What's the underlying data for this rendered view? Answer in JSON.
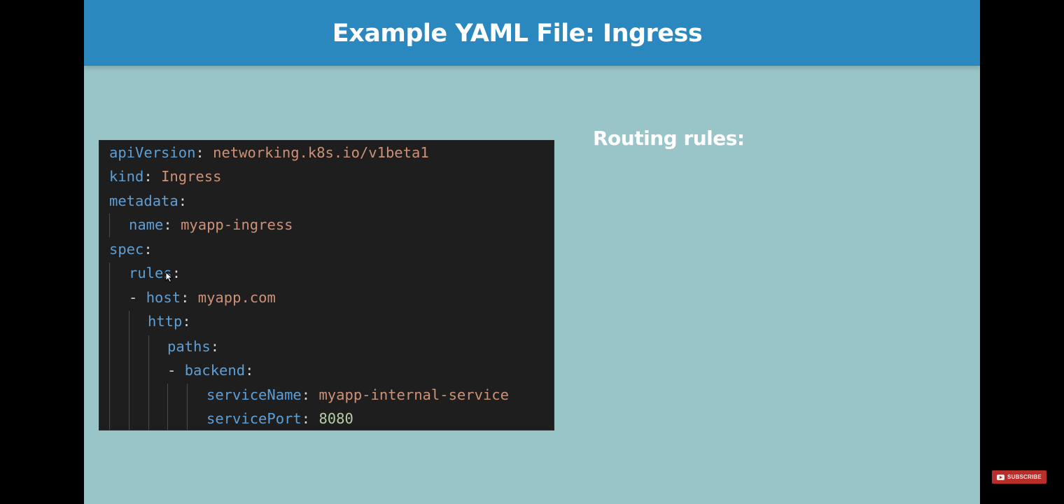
{
  "slide": {
    "title": "Example YAML File: Ingress",
    "side_heading": "Routing rules:"
  },
  "code": {
    "lines": [
      {
        "key": "apiVersion",
        "value": "networking.k8s.io/v1beta1"
      },
      {
        "key": "kind",
        "value": "Ingress"
      },
      {
        "key": "metadata",
        "value": ""
      },
      {
        "key": "name",
        "value": "myapp-ingress"
      },
      {
        "key": "spec",
        "value": ""
      },
      {
        "key": "rules",
        "value": ""
      },
      {
        "key": "host",
        "value": "myapp.com"
      },
      {
        "key": "http",
        "value": ""
      },
      {
        "key": "paths",
        "value": ""
      },
      {
        "key": "backend",
        "value": ""
      },
      {
        "key": "serviceName",
        "value": "myapp-internal-service"
      },
      {
        "key": "servicePort",
        "value": "8080"
      }
    ],
    "colors": {
      "background": "#1e1e1e",
      "key": "#5e9fd6",
      "string": "#ce9178",
      "number": "#b5cea8",
      "punctuation": "#d4d4d4"
    }
  },
  "overlay": {
    "subscribe_label": "SUBSCRIBE",
    "subscribe_icon": "play-icon",
    "cursor_icon": "mouse-cursor-icon"
  },
  "colors": {
    "header": "#2b88bf",
    "slide_background": "#9ac5c8",
    "subscribe": "#c8322f"
  }
}
